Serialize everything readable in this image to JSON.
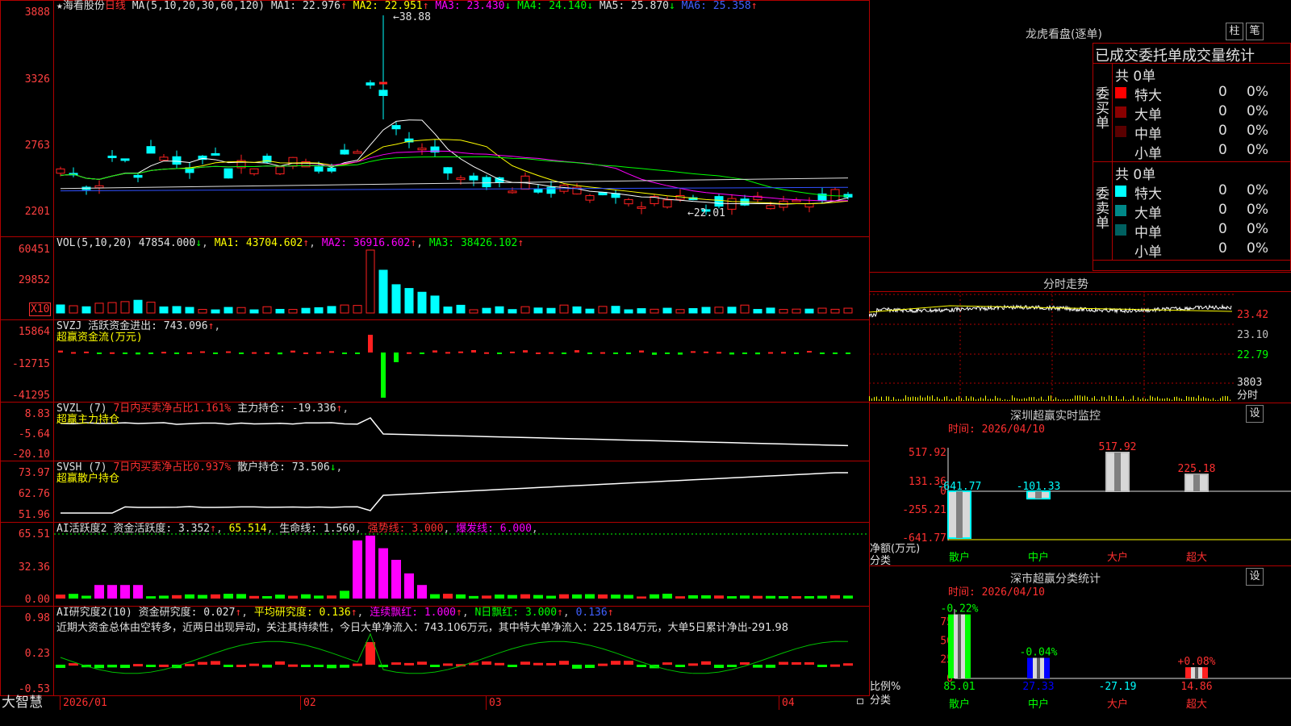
{
  "app": {
    "logo": "大智慧"
  },
  "main": {
    "header": {
      "star": "★",
      "name": "海看股份",
      "period": "日线",
      "ma_label": "MA(5,10,20,30,60,120)",
      "ma1": "MA1: 22.976",
      "ma1_arrow": "↑",
      "ma2": "MA2: 22.951",
      "ma2_arrow": "↑",
      "ma3": "MA3: 23.430",
      "ma3_arrow": "↓",
      "ma4": "MA4: 24.140",
      "ma4_arrow": "↓",
      "ma5": "MA5: 25.870",
      "ma5_arrow": "↓",
      "ma6": "MA6: 25.358",
      "ma6_arrow": "↑"
    },
    "axis": [
      "3888",
      "3326",
      "2763",
      "2201"
    ],
    "high_label": "←38.88",
    "low_label": "←22.01"
  },
  "vol": {
    "header": {
      "name": "VOL(5,10,20)",
      "value": "47854.000",
      "arrow": "↓",
      "ma1": "MA1: 43704.602",
      "ma1_arrow": "↑",
      "ma2": "MA2: 36916.602",
      "ma2_arrow": "↑",
      "ma3": "MA3: 38426.102",
      "ma3_arrow": "↑"
    },
    "axis": [
      "60451",
      "29852"
    ],
    "unit": "X10"
  },
  "svzj": {
    "header": {
      "name": "SVZJ",
      "t1": "活跃资金进出: 743.096",
      "arrow": "↑",
      "t2": "超赢资金流(万元)"
    },
    "axis": [
      "15864",
      "-12715",
      "-41295"
    ]
  },
  "svzl": {
    "header": {
      "name": "SVZL (7)",
      "t1": "7日内买卖净占比1.161%",
      "t2": "主力持仓: -19.336",
      "arrow": "↑",
      "t3": "超赢主力持仓"
    },
    "axis": [
      "8.83",
      "-5.64",
      "-20.10"
    ]
  },
  "svsh": {
    "header": {
      "name": "SVSH (7)",
      "t1": "7日内买卖净占比0.937%",
      "t2": "散户持仓: 73.506",
      "arrow": "↓",
      "t3": "超赢散户持仓"
    },
    "axis": [
      "73.97",
      "62.76",
      "51.96"
    ]
  },
  "ai1": {
    "header": {
      "name": "AI活跃度2",
      "t1": "资金活跃度: 3.352",
      "arrow": "↑",
      "t2": "65.514",
      "t3": "生命线: 1.560",
      "t4": "强势线: 3.000",
      "t5": "爆发线: 6.000"
    },
    "axis": [
      "65.51",
      "32.36",
      "0.00"
    ]
  },
  "ai2": {
    "header": {
      "name": "AI研究度2(10)",
      "t1": "资金研究度: 0.027",
      "a1": "↑",
      "t2": "平均研究度: 0.136",
      "a2": "↑",
      "t3": "连续飘红: 1.000",
      "a3": "↑",
      "t4": "N日飘红: 3.000",
      "a4": "↑",
      "t5": "0.136",
      "a5": "↑"
    },
    "comment": "近期大资金总体由空转多，近两日出现异动，关注其持续性，今日大单净流入：743.106万元，其中特大单净流入：225.184万元，大单5日累计净出-291.98",
    "axis": [
      "0.98",
      "0.23",
      "-0.53"
    ]
  },
  "xaxis": {
    "labels": [
      "2026/01",
      "02",
      "03",
      "04"
    ]
  },
  "dragon": {
    "title": "龙虎看盘(逐单)",
    "btn1": "柱",
    "btn2": "笔",
    "subtitle": "已成交委托单成交量统计",
    "buy": {
      "side": "委买单",
      "total": "共 0单",
      "rows": [
        {
          "name": "特大",
          "count": "0",
          "pct": "0%",
          "color": "#ff0000"
        },
        {
          "name": "大单",
          "count": "0",
          "pct": "0%",
          "color": "#8a0000"
        },
        {
          "name": "中单",
          "count": "0",
          "pct": "0%",
          "color": "#5a0000"
        },
        {
          "name": "小单",
          "count": "0",
          "pct": "0%",
          "color": ""
        }
      ]
    },
    "sell": {
      "side": "委卖单",
      "total": "共 0单",
      "rows": [
        {
          "name": "特大",
          "count": "0",
          "pct": "0%",
          "color": "#00ffff"
        },
        {
          "name": "大单",
          "count": "0",
          "pct": "0%",
          "color": "#008888"
        },
        {
          "name": "中单",
          "count": "0",
          "pct": "0%",
          "color": "#006060"
        },
        {
          "name": "小单",
          "count": "0",
          "pct": "0%",
          "color": ""
        }
      ]
    }
  },
  "intraday": {
    "title": "分时走势",
    "axis": [
      "23.42",
      "23.10",
      "22.79",
      "3803",
      "分时"
    ]
  },
  "monitor": {
    "title": "深圳超赢实时监控",
    "btn": "设",
    "time": "时间: 2026/04/10",
    "ylabel": "净额(万元)",
    "xlabel": "分类",
    "axis": [
      "517.92",
      "131.36",
      "0",
      "-255.21",
      "-641.77"
    ],
    "bars": [
      {
        "cat": "散户",
        "value": -641.77,
        "label": "-641.77"
      },
      {
        "cat": "中户",
        "value": -101.33,
        "label": "-101.33"
      },
      {
        "cat": "大户",
        "value": 517.92,
        "label": "517.92"
      },
      {
        "cat": "超大",
        "value": 225.18,
        "label": "225.18"
      }
    ]
  },
  "classify": {
    "title": "深市超赢分类统计",
    "btn": "设",
    "time": "时间: 2026/04/10",
    "ylabel": "比例%",
    "xlabel": "分类",
    "axis": [
      "75",
      "50",
      "25",
      "0"
    ],
    "bars": [
      {
        "cat": "散户",
        "value": 85.01,
        "pct": "-0.22%",
        "label": "85.01"
      },
      {
        "cat": "中户",
        "value": 27.33,
        "pct": "-0.04%",
        "label": "27.33"
      },
      {
        "cat": "大户",
        "value": -27.19,
        "pct": "",
        "label": "-27.19"
      },
      {
        "cat": "超大",
        "value": 14.86,
        "pct": "+0.08%",
        "label": "14.86"
      }
    ]
  }
}
